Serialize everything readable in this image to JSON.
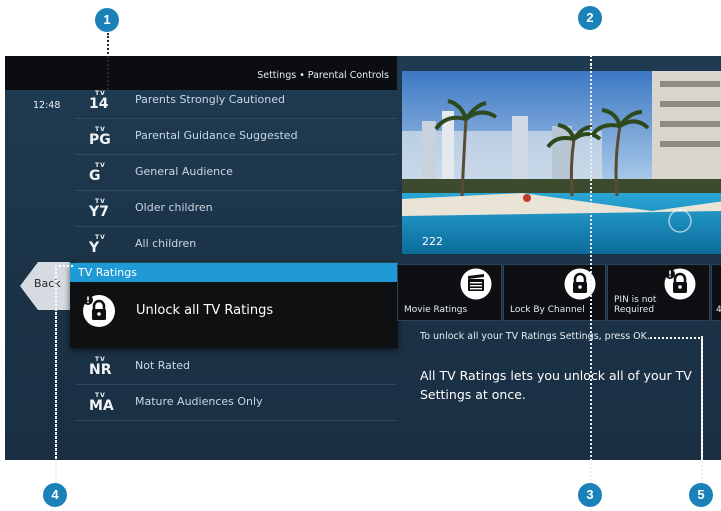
{
  "header": {
    "title": "Settings • Parental Controls",
    "time": "12:48"
  },
  "ratings_top": [
    {
      "badge_top": "TV",
      "badge_code": "14",
      "label": "Parents Strongly Cautioned"
    },
    {
      "badge_top": "TV",
      "badge_code": "PG",
      "label": "Parental Guidance Suggested"
    },
    {
      "badge_top": "TV",
      "badge_code": "G",
      "label": "General Audience"
    },
    {
      "badge_top": "TV",
      "badge_code": "Y7",
      "label": "Older children"
    },
    {
      "badge_top": "TV",
      "badge_code": "Y",
      "label": "All children"
    }
  ],
  "ratings_bottom": [
    {
      "badge_top": "TV",
      "badge_code": "NR",
      "label": "Not Rated"
    },
    {
      "badge_top": "TV",
      "badge_code": "MA",
      "label": "Mature Audiences Only"
    }
  ],
  "back": {
    "label": "Back"
  },
  "popup": {
    "title": "TV Ratings",
    "action": "Unlock all TV Ratings",
    "icon": "padlock-icon"
  },
  "preview": {
    "channel": "222"
  },
  "tiles": [
    {
      "label": "Movie Ratings",
      "icon": "clapperboard-icon"
    },
    {
      "label": "Lock By Channel",
      "icon": "padlock-icon"
    },
    {
      "label": "PIN is not Required",
      "label_line1": "PIN is not",
      "label_line2": "Required",
      "icon": "padlock-icon"
    },
    {
      "label": "4",
      "icon": ""
    }
  ],
  "info": {
    "instruction": "To unlock all your TV Ratings Settings, press OK.",
    "description": "All TV Ratings lets you unlock all of your TV Settings at once."
  },
  "callouts": [
    "1",
    "2",
    "3",
    "4",
    "5"
  ],
  "colors": {
    "accent": "#1f9ad6",
    "callout": "#1a82b8",
    "background": "#1d3649",
    "popup": "#0e1012"
  }
}
